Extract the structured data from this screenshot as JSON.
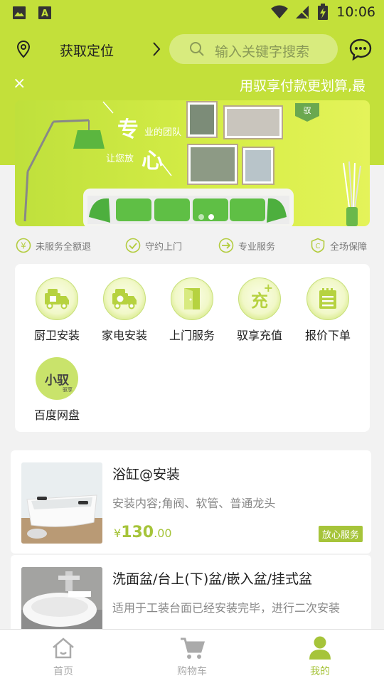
{
  "status_bar": {
    "time": "10:06"
  },
  "header": {
    "location_label": "获取定位",
    "search_placeholder": "输入关键字搜索"
  },
  "notice": {
    "close": "×",
    "text": "用驭享付款更划算,最"
  },
  "banner": {
    "line1_big": "专",
    "line1_small": "业的团队",
    "line2_small": "让您放",
    "line2_big": "心",
    "badge": "驭",
    "page_count": 2,
    "active_page": 2
  },
  "guarantees": [
    {
      "label": "未服务全额退",
      "icon": "yen-circle-icon"
    },
    {
      "label": "守约上门",
      "icon": "check-circle-icon"
    },
    {
      "label": "专业服务",
      "icon": "arrow-circle-icon"
    },
    {
      "label": "全场保障",
      "icon": "shield-c-icon"
    }
  ],
  "services": [
    {
      "label": "厨卫安装",
      "icon": "kitchen-truck-icon"
    },
    {
      "label": "家电安装",
      "icon": "appliance-truck-icon"
    },
    {
      "label": "上门服务",
      "icon": "door-icon"
    },
    {
      "label": "驭享充值",
      "icon": "recharge-icon",
      "glyph": "充"
    },
    {
      "label": "报价下单",
      "icon": "notepad-icon"
    },
    {
      "label": "百度网盘",
      "icon": "xiaoyu-logo",
      "glyph": "小驭",
      "sub": "驭享"
    }
  ],
  "products": [
    {
      "title": "浴缸@安装",
      "desc": "安装内容;角阀、软管、普通龙头",
      "price_currency": "¥",
      "price_int": "130",
      "price_dec": ".00",
      "tag": "放心服务"
    },
    {
      "title": "洗面盆/台上(下)盆/嵌入盆/挂式盆",
      "desc": "适用于工装台面已经安装完毕，进行二次安装"
    }
  ],
  "tabbar": [
    {
      "label": "首页",
      "icon": "home-icon",
      "active": false
    },
    {
      "label": "购物车",
      "icon": "cart-icon",
      "active": false
    },
    {
      "label": "我的",
      "icon": "user-icon",
      "active": true
    }
  ],
  "colors": {
    "accent": "#c3e03a",
    "price": "#a6c43a"
  }
}
